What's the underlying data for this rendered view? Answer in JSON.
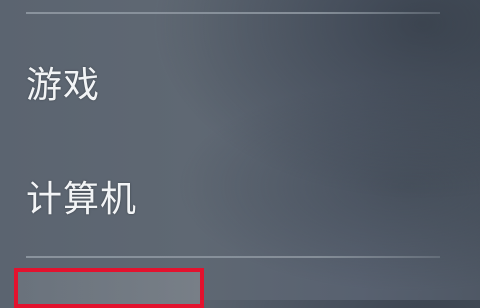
{
  "start_menu": {
    "items": [
      {
        "label": "游戏"
      },
      {
        "label": "计算机"
      }
    ],
    "highlight": {
      "color": "#e3122e",
      "label": ""
    }
  }
}
